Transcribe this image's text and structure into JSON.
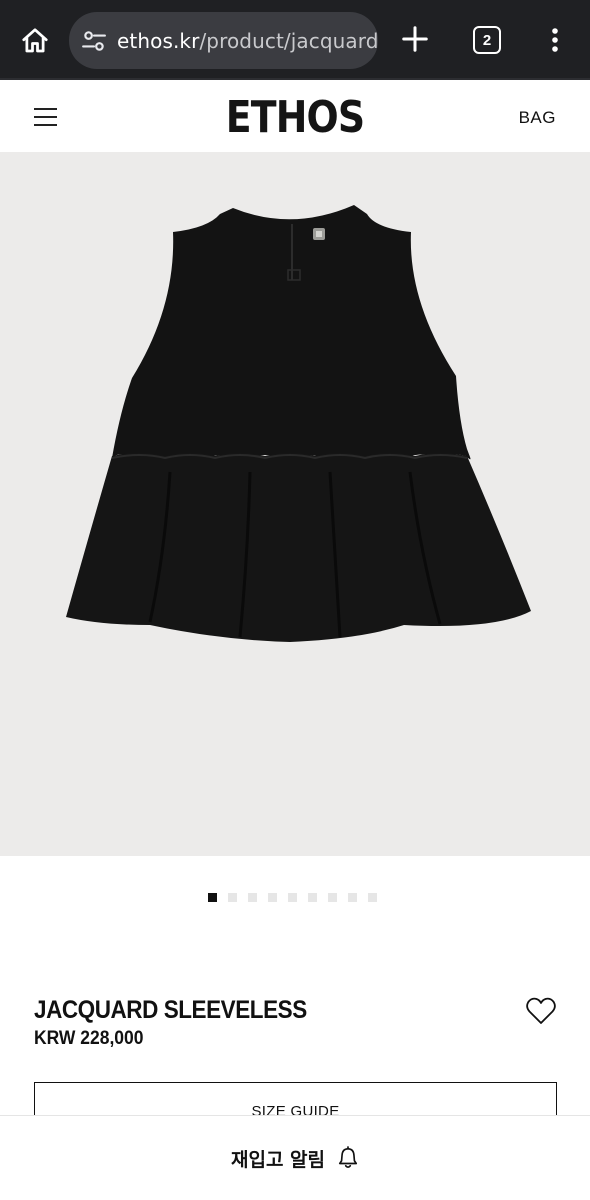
{
  "browser": {
    "url_domain": "ethos.kr",
    "url_path": "/product/jacquard-sl",
    "tab_count": "2"
  },
  "header": {
    "logo": "ETHOS",
    "bag_label": "BAG"
  },
  "carousel": {
    "total_slides": 9,
    "active_index": 0
  },
  "product": {
    "name": "JACQUARD SLEEVELESS",
    "price": "KRW 228,000",
    "size_guide_label": "SIZE GUIDE"
  },
  "restock": {
    "label": "재입고 알림"
  },
  "icons": {
    "home": "home-icon",
    "site_settings": "tune-icon",
    "new_tab": "plus-icon",
    "menu": "more-vert-icon",
    "hamburger": "hamburger-menu-icon",
    "wishlist": "heart-outline-icon",
    "restock": "bell-icon"
  },
  "colors": {
    "browser_bg": "#1f2023",
    "url_pill": "#3b3c41",
    "image_bg": "#ecebea",
    "garment": "#121212",
    "text": "#111111"
  }
}
